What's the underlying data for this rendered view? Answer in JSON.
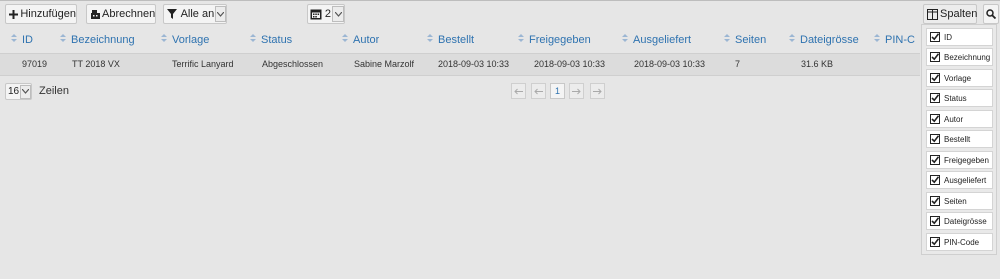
{
  "toolbar": {
    "add_label": "Hinzufügen",
    "bill_label": "Abrechnen",
    "filter_value": "Alle an",
    "date_value": "2",
    "columns_label": "Spalten"
  },
  "table": {
    "headers": [
      "ID",
      "Bezeichnung",
      "Vorlage",
      "Status",
      "Autor",
      "Bestellt",
      "Freigegeben",
      "Ausgeliefert",
      "Seiten",
      "Dateigrösse",
      "PIN-C"
    ],
    "rows": [
      [
        "97019",
        "TT 2018 VX",
        "Terrific Lanyard",
        "Abgeschlossen",
        "Sabine Marzolf",
        "2018-09-03 10:33",
        "2018-09-03 10:33",
        "2018-09-03 10:33",
        "7",
        "31.6 KB",
        ""
      ]
    ]
  },
  "paging": {
    "page_size": "16",
    "page_size_suffix": "Zeilen",
    "current_page": "1"
  },
  "columns_menu": {
    "items": [
      "ID",
      "Bezeichnung",
      "Vorlage",
      "Status",
      "Autor",
      "Bestellt",
      "Freigegeben",
      "Ausgeliefert",
      "Seiten",
      "Dateigrösse",
      "PIN-Code"
    ]
  },
  "colors": {
    "accent": "#2f73b0",
    "background": "#e6e6e6",
    "row_highlight": "#dcdcdc"
  }
}
